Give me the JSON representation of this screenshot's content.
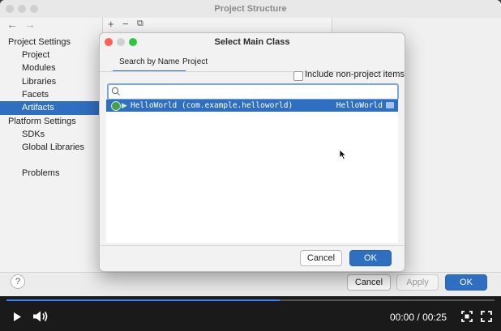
{
  "project_structure": {
    "title": "Project Structure",
    "toolbar": {
      "add": "+",
      "remove": "−",
      "copy": "⧉"
    },
    "sidebar": {
      "project_settings_label": "Project Settings",
      "items_project": [
        "Project",
        "Modules",
        "Libraries",
        "Facets",
        "Artifacts"
      ],
      "selected_item": "Artifacts",
      "platform_settings_label": "Platform Settings",
      "items_platform": [
        "SDKs",
        "Global Libraries"
      ],
      "problems_label": "Problems"
    },
    "buttons": {
      "help": "?",
      "cancel": "Cancel",
      "apply": "Apply",
      "ok": "OK"
    }
  },
  "dialog": {
    "title": "Select Main Class",
    "tabs": [
      {
        "label": "Search by Name",
        "active": true
      },
      {
        "label": "Project",
        "active": false
      }
    ],
    "include_non_project_label": "Include non-project items",
    "include_non_project_checked": false,
    "search": {
      "value": "",
      "placeholder": ""
    },
    "results": [
      {
        "class_text": "HelloWorld (com.example.helloworld)",
        "module": "HelloWorld",
        "selected": true
      }
    ],
    "buttons": {
      "cancel": "Cancel",
      "ok": "OK"
    }
  },
  "player": {
    "current_time": "00:00",
    "separator": "/",
    "duration": "00:25",
    "progress_fraction": 0.56
  },
  "colors": {
    "accent": "#2f6fc1",
    "progress": "#3b82f6"
  }
}
